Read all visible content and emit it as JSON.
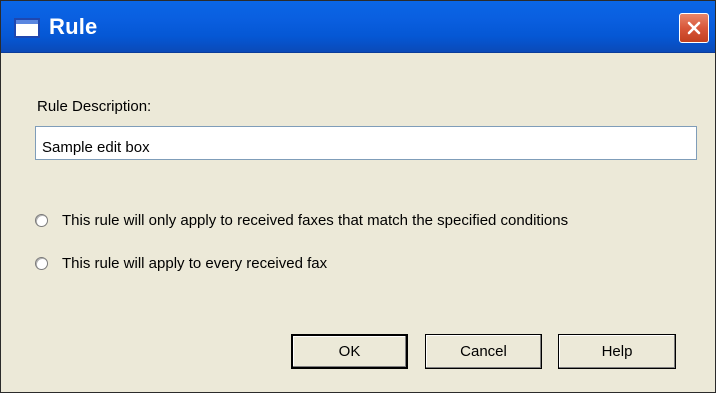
{
  "window": {
    "title": "Rule"
  },
  "form": {
    "description_label": "Rule Description:",
    "description_value": "Sample edit box",
    "options": [
      {
        "label": "This rule will only apply to received faxes that match the specified conditions",
        "selected": false
      },
      {
        "label": "This rule will apply to every received fax",
        "selected": false
      }
    ]
  },
  "buttons": {
    "ok": "OK",
    "cancel": "Cancel",
    "help": "Help"
  },
  "icons": {
    "app": "window-icon",
    "close": "close-icon"
  },
  "colors": {
    "titlebar": "#0a5fe0",
    "dialog_bg": "#ece9d8",
    "close": "#d8573a"
  }
}
